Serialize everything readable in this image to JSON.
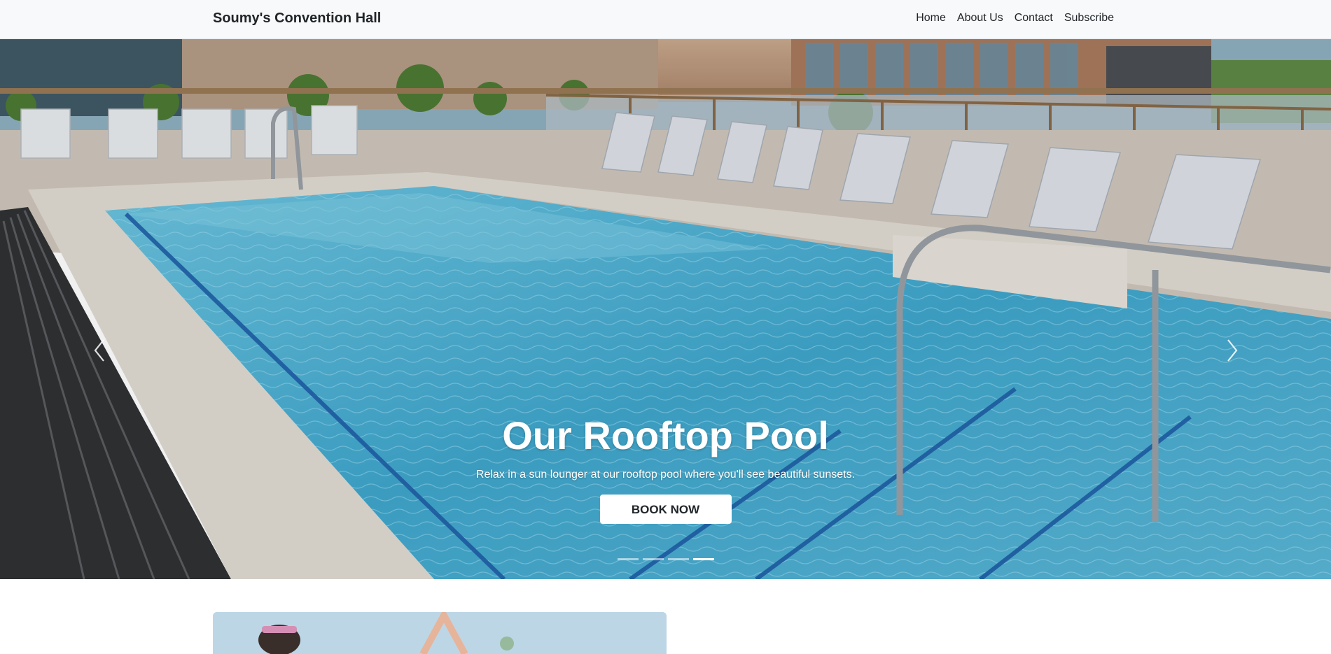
{
  "navbar": {
    "brand": "Soumy's Convention Hall",
    "links": [
      "Home",
      "About Us",
      "Contact",
      "Subscribe"
    ]
  },
  "hero": {
    "title": "Our Rooftop Pool",
    "subtitle": "Relax in a sun lounger at our rooftop pool where you'll see beautiful sunsets.",
    "button_label": "BOOK NOW",
    "slide_count": 4,
    "active_slide": 4,
    "prev_icon": "chevron-left-icon",
    "next_icon": "chevron-right-icon"
  },
  "colors": {
    "navbar_bg": "#f8f9fa",
    "pool_water": "#4fb3d4",
    "button_bg": "#ffffff"
  }
}
